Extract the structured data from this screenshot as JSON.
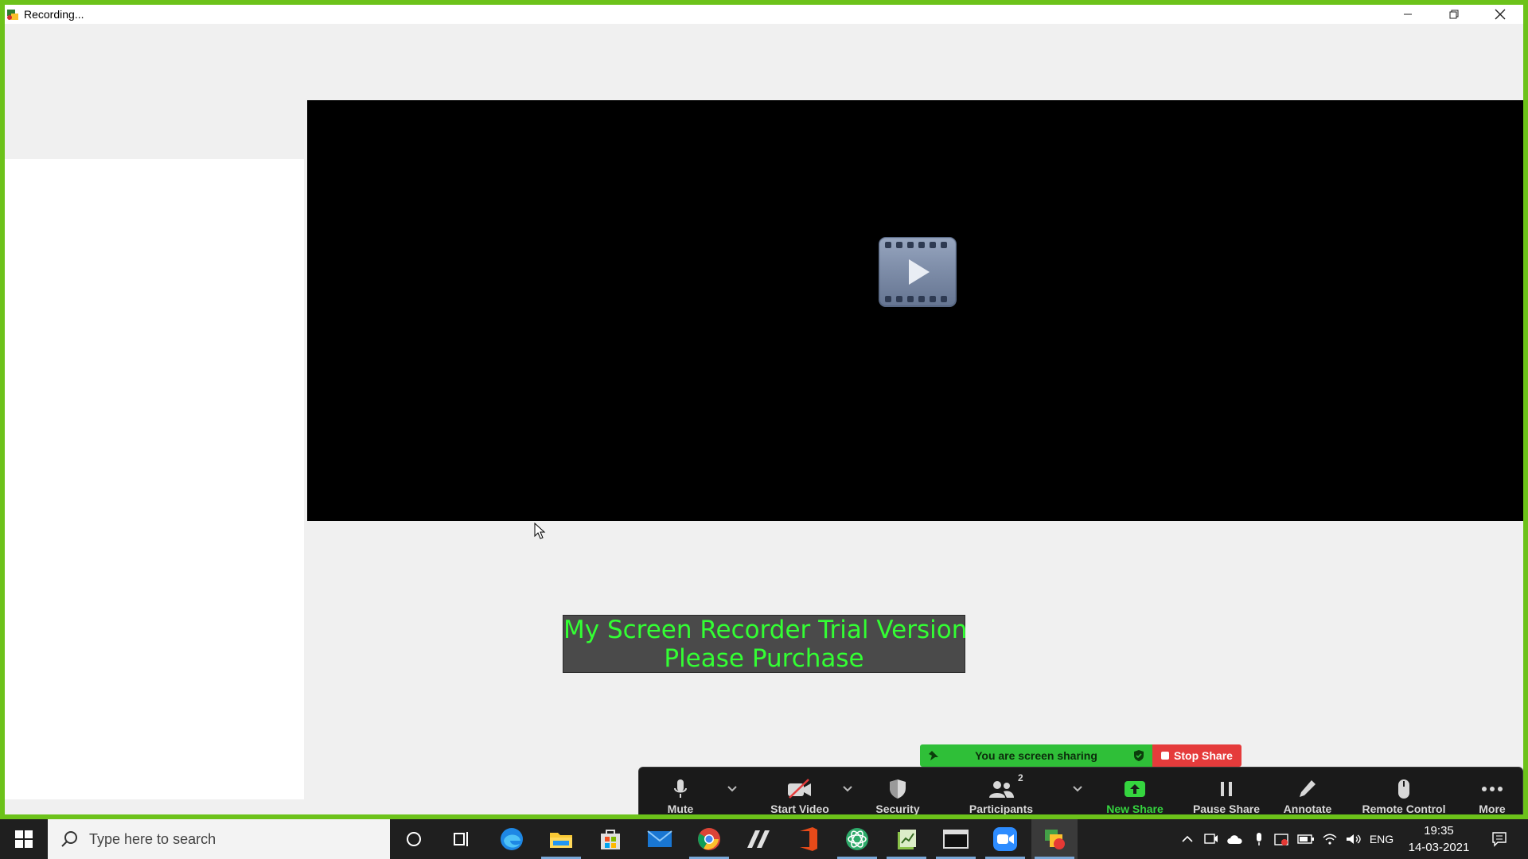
{
  "window": {
    "title": "Recording..."
  },
  "watermark": {
    "line1": "My Screen Recorder Trial Version",
    "line2": "Please Purchase"
  },
  "share_banner": {
    "label": "You are screen sharing",
    "stop_label": "Stop Share"
  },
  "toolbar": {
    "mute": "Mute",
    "start_video": "Start Video",
    "security": "Security",
    "participants": "Participants",
    "participants_count": "2",
    "new_share": "New Share",
    "pause_share": "Pause Share",
    "annotate": "Annotate",
    "remote_control": "Remote Control",
    "more": "More"
  },
  "taskbar": {
    "search_placeholder": "Type here to search",
    "language": "ENG",
    "time": "19:35",
    "date": "14-03-2021"
  },
  "colors": {
    "share_border": "#6cc21a",
    "watermark_text": "#33ff33",
    "share_green": "#2fbf38",
    "stop_red": "#e53b3b"
  }
}
